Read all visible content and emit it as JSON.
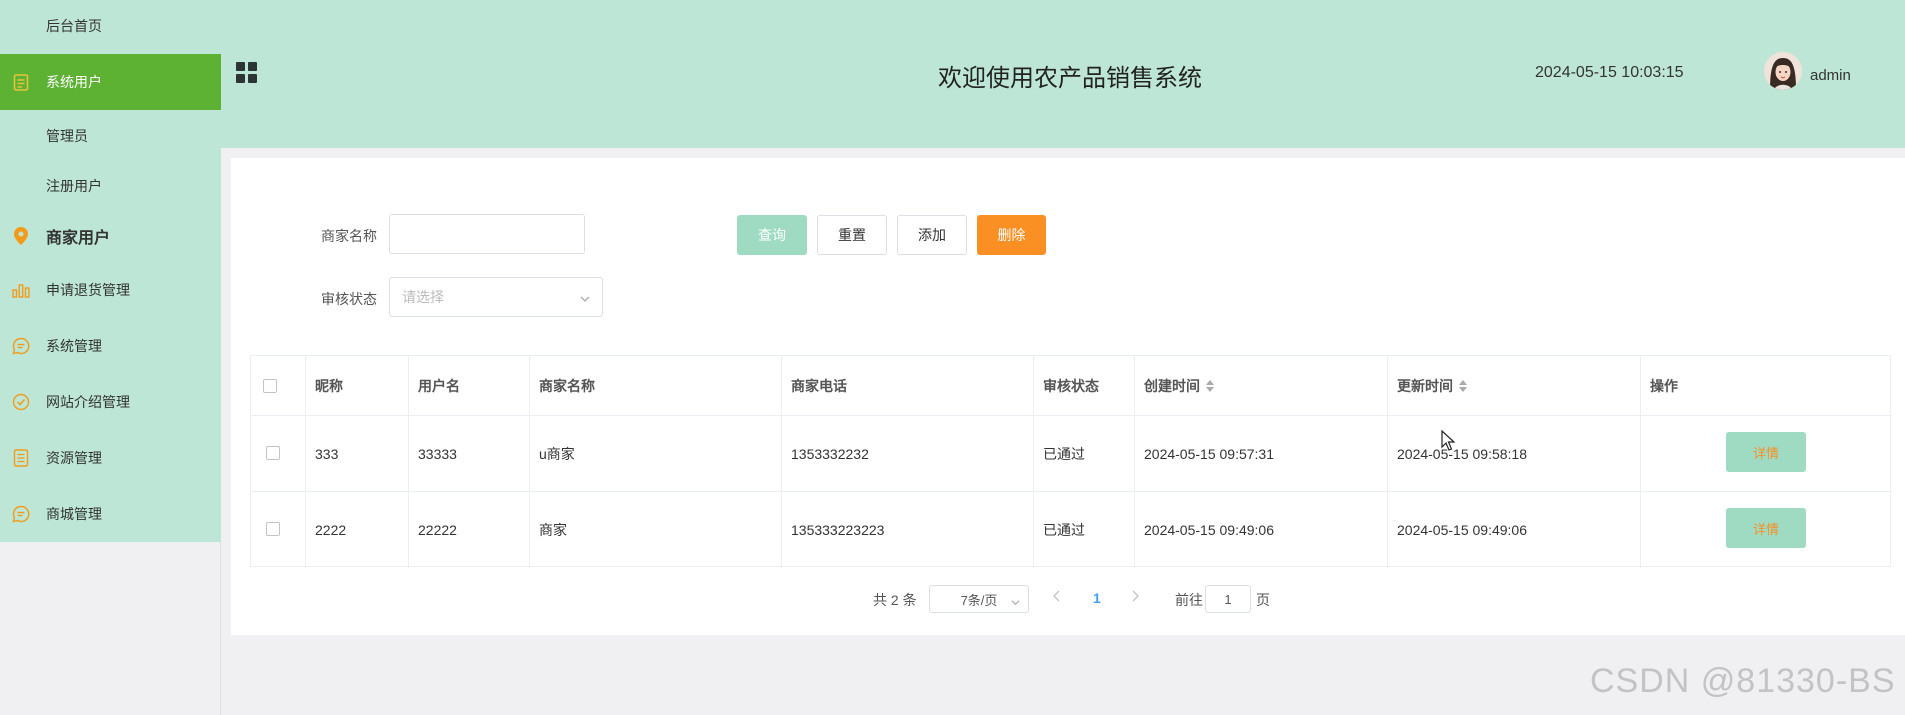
{
  "sidebar": {
    "items": [
      {
        "label": "后台首页",
        "icon": "none"
      },
      {
        "label": "系统用户",
        "icon": "clipboard-icon"
      },
      {
        "label": "管理员",
        "icon": "none"
      },
      {
        "label": "注册用户",
        "icon": "none"
      },
      {
        "label": "商家用户",
        "icon": "location-pin-icon"
      },
      {
        "label": "申请退货管理",
        "icon": "bar-chart-icon"
      },
      {
        "label": "系统管理",
        "icon": "chat-icon"
      },
      {
        "label": "网站介绍管理",
        "icon": "check-circle-icon"
      },
      {
        "label": "资源管理",
        "icon": "document-icon"
      },
      {
        "label": "商城管理",
        "icon": "chat-icon"
      }
    ],
    "active_color": "#5db234",
    "bg_color": "#bde6d6"
  },
  "header": {
    "title": "欢迎使用农产品销售系统",
    "datetime": "2024-05-15 10:03:15",
    "username": "admin"
  },
  "search": {
    "merchant_name_label": "商家名称",
    "merchant_name_value": "",
    "audit_status_label": "审核状态",
    "audit_status_placeholder": "请选择",
    "query_label": "查询",
    "reset_label": "重置",
    "add_label": "添加",
    "delete_label": "删除"
  },
  "table": {
    "columns": [
      "昵称",
      "用户名",
      "商家名称",
      "商家电话",
      "审核状态",
      "创建时间",
      "更新时间",
      "操作"
    ],
    "rows": [
      {
        "nickname": "333",
        "username": "33333",
        "merchant_name": "u商家",
        "phone": "1353332232",
        "status": "已通过",
        "created": "2024-05-15 09:57:31",
        "updated": "2024-05-15 09:58:18",
        "action": "详情"
      },
      {
        "nickname": "2222",
        "username": "22222",
        "merchant_name": "商家",
        "phone": "135333223223",
        "status": "已通过",
        "created": "2024-05-15 09:49:06",
        "updated": "2024-05-15 09:49:06",
        "action": "详情"
      }
    ]
  },
  "pagination": {
    "total_text": "共 2 条",
    "page_size": "7条/页",
    "current_page": "1",
    "goto_prefix": "前往",
    "goto_value": "1",
    "goto_suffix": "页"
  },
  "watermark": "CSDN @81330-BS",
  "colors": {
    "accent_green": "#9fdbc3",
    "delete_orange": "#fa8f24"
  }
}
